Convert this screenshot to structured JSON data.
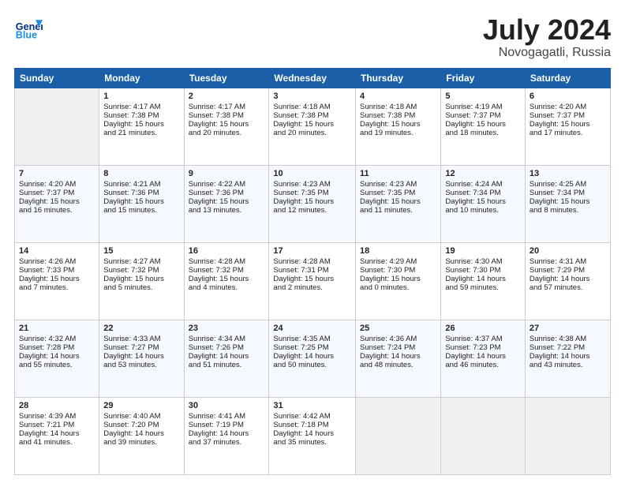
{
  "header": {
    "logo_line1": "General",
    "logo_line2": "Blue",
    "month": "July 2024",
    "location": "Novogagatli, Russia"
  },
  "weekdays": [
    "Sunday",
    "Monday",
    "Tuesday",
    "Wednesday",
    "Thursday",
    "Friday",
    "Saturday"
  ],
  "weeks": [
    [
      {
        "day": "",
        "content": ""
      },
      {
        "day": "1",
        "content": "Sunrise: 4:17 AM\nSunset: 7:38 PM\nDaylight: 15 hours\nand 21 minutes."
      },
      {
        "day": "2",
        "content": "Sunrise: 4:17 AM\nSunset: 7:38 PM\nDaylight: 15 hours\nand 20 minutes."
      },
      {
        "day": "3",
        "content": "Sunrise: 4:18 AM\nSunset: 7:38 PM\nDaylight: 15 hours\nand 20 minutes."
      },
      {
        "day": "4",
        "content": "Sunrise: 4:18 AM\nSunset: 7:38 PM\nDaylight: 15 hours\nand 19 minutes."
      },
      {
        "day": "5",
        "content": "Sunrise: 4:19 AM\nSunset: 7:37 PM\nDaylight: 15 hours\nand 18 minutes."
      },
      {
        "day": "6",
        "content": "Sunrise: 4:20 AM\nSunset: 7:37 PM\nDaylight: 15 hours\nand 17 minutes."
      }
    ],
    [
      {
        "day": "7",
        "content": "Sunrise: 4:20 AM\nSunset: 7:37 PM\nDaylight: 15 hours\nand 16 minutes."
      },
      {
        "day": "8",
        "content": "Sunrise: 4:21 AM\nSunset: 7:36 PM\nDaylight: 15 hours\nand 15 minutes."
      },
      {
        "day": "9",
        "content": "Sunrise: 4:22 AM\nSunset: 7:36 PM\nDaylight: 15 hours\nand 13 minutes."
      },
      {
        "day": "10",
        "content": "Sunrise: 4:23 AM\nSunset: 7:35 PM\nDaylight: 15 hours\nand 12 minutes."
      },
      {
        "day": "11",
        "content": "Sunrise: 4:23 AM\nSunset: 7:35 PM\nDaylight: 15 hours\nand 11 minutes."
      },
      {
        "day": "12",
        "content": "Sunrise: 4:24 AM\nSunset: 7:34 PM\nDaylight: 15 hours\nand 10 minutes."
      },
      {
        "day": "13",
        "content": "Sunrise: 4:25 AM\nSunset: 7:34 PM\nDaylight: 15 hours\nand 8 minutes."
      }
    ],
    [
      {
        "day": "14",
        "content": "Sunrise: 4:26 AM\nSunset: 7:33 PM\nDaylight: 15 hours\nand 7 minutes."
      },
      {
        "day": "15",
        "content": "Sunrise: 4:27 AM\nSunset: 7:32 PM\nDaylight: 15 hours\nand 5 minutes."
      },
      {
        "day": "16",
        "content": "Sunrise: 4:28 AM\nSunset: 7:32 PM\nDaylight: 15 hours\nand 4 minutes."
      },
      {
        "day": "17",
        "content": "Sunrise: 4:28 AM\nSunset: 7:31 PM\nDaylight: 15 hours\nand 2 minutes."
      },
      {
        "day": "18",
        "content": "Sunrise: 4:29 AM\nSunset: 7:30 PM\nDaylight: 15 hours\nand 0 minutes."
      },
      {
        "day": "19",
        "content": "Sunrise: 4:30 AM\nSunset: 7:30 PM\nDaylight: 14 hours\nand 59 minutes."
      },
      {
        "day": "20",
        "content": "Sunrise: 4:31 AM\nSunset: 7:29 PM\nDaylight: 14 hours\nand 57 minutes."
      }
    ],
    [
      {
        "day": "21",
        "content": "Sunrise: 4:32 AM\nSunset: 7:28 PM\nDaylight: 14 hours\nand 55 minutes."
      },
      {
        "day": "22",
        "content": "Sunrise: 4:33 AM\nSunset: 7:27 PM\nDaylight: 14 hours\nand 53 minutes."
      },
      {
        "day": "23",
        "content": "Sunrise: 4:34 AM\nSunset: 7:26 PM\nDaylight: 14 hours\nand 51 minutes."
      },
      {
        "day": "24",
        "content": "Sunrise: 4:35 AM\nSunset: 7:25 PM\nDaylight: 14 hours\nand 50 minutes."
      },
      {
        "day": "25",
        "content": "Sunrise: 4:36 AM\nSunset: 7:24 PM\nDaylight: 14 hours\nand 48 minutes."
      },
      {
        "day": "26",
        "content": "Sunrise: 4:37 AM\nSunset: 7:23 PM\nDaylight: 14 hours\nand 46 minutes."
      },
      {
        "day": "27",
        "content": "Sunrise: 4:38 AM\nSunset: 7:22 PM\nDaylight: 14 hours\nand 43 minutes."
      }
    ],
    [
      {
        "day": "28",
        "content": "Sunrise: 4:39 AM\nSunset: 7:21 PM\nDaylight: 14 hours\nand 41 minutes."
      },
      {
        "day": "29",
        "content": "Sunrise: 4:40 AM\nSunset: 7:20 PM\nDaylight: 14 hours\nand 39 minutes."
      },
      {
        "day": "30",
        "content": "Sunrise: 4:41 AM\nSunset: 7:19 PM\nDaylight: 14 hours\nand 37 minutes."
      },
      {
        "day": "31",
        "content": "Sunrise: 4:42 AM\nSunset: 7:18 PM\nDaylight: 14 hours\nand 35 minutes."
      },
      {
        "day": "",
        "content": ""
      },
      {
        "day": "",
        "content": ""
      },
      {
        "day": "",
        "content": ""
      }
    ]
  ]
}
